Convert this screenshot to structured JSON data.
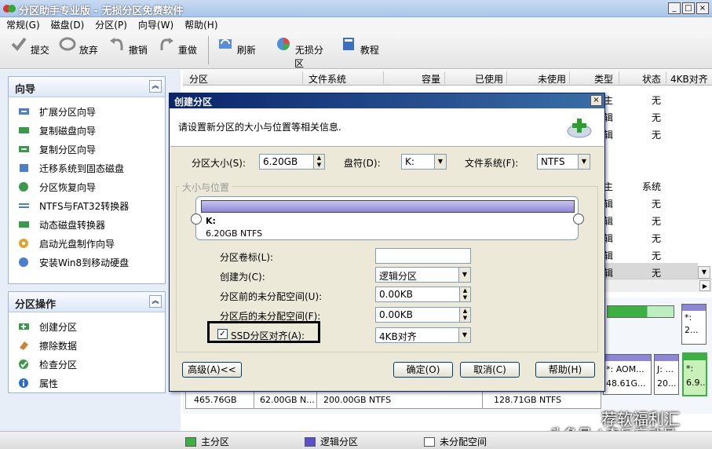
{
  "window": {
    "title": "分区助手专业版 - 无损分区免费软件",
    "min": "_",
    "max": "□",
    "close": "×"
  },
  "menu": [
    "常规(G)",
    "磁盘(D)",
    "分区(P)",
    "向导(W)",
    "帮助(H)"
  ],
  "toolbar": {
    "commit": "提交",
    "discard": "放弃",
    "undo": "撤销",
    "redo": "重做",
    "refresh": "刷新",
    "lossless": "无损分区",
    "tutorial": "教程"
  },
  "wizard_panel": {
    "title": "向导",
    "items": [
      "扩展分区向导",
      "复制磁盘向导",
      "复制分区向导",
      "迁移系统到固态磁盘",
      "分区恢复向导",
      "NTFS与FAT32转换器",
      "动态磁盘转换器",
      "启动光盘制作向导",
      "安装Win8到移动硬盘"
    ]
  },
  "ops_panel": {
    "title": "分区操作",
    "items": [
      "创建分区",
      "擦除数据",
      "检查分区",
      "属性"
    ]
  },
  "columns": [
    "分区",
    "文件系统",
    "容量",
    "已使用",
    "未使用",
    "类型",
    "状态",
    "4KB对齐"
  ],
  "visible_cells": {
    "type": [
      "主",
      "辑",
      "辑",
      "主",
      "辑",
      "辑",
      "辑",
      "辑",
      "辑"
    ],
    "status": [
      "无",
      "无",
      "无",
      "系统",
      "无",
      "无",
      "无",
      "无",
      "无"
    ]
  },
  "disk_map": {
    "disk_size": "465.76GB",
    "p1": "62.00GB N...",
    "p2": "200.00GB NTFS",
    "p3": "128.71GB NTFS",
    "p4_name": "*: AOM...",
    "p4_size": "48.61G...",
    "p5_name": "J: ...",
    "p5_size": "20...",
    "p6_name": "*:",
    "p6_size": "6.9..",
    "p7_name": "*:",
    "p7_size": "2..."
  },
  "legend": {
    "primary": "主分区",
    "logical": "逻辑分区",
    "unallocated": "未分配空间"
  },
  "watermark": {
    "line1": "荐软福利汇",
    "line2": "头条号 / 奇乐忘动员"
  },
  "dialog": {
    "title": "创建分区",
    "close": "×",
    "desc": "请设置新分区的大小与位置等相关信息.",
    "size_label": "分区大小(S):",
    "size_value": "6.20GB",
    "drive_label": "盘符(D):",
    "drive_value": "K:",
    "fs_label": "文件系统(F):",
    "fs_value": "NTFS",
    "group_label": "大小与位置",
    "bar_drive": "K:",
    "bar_info": "6.20GB NTFS",
    "volume_label": "分区卷标(L):",
    "volume_value": "",
    "create_as_label": "创建为(C):",
    "create_as_value": "逻辑分区",
    "before_label": "分区前的未分配空间(U):",
    "before_value": "0.00KB",
    "after_label": "分区后的未分配空间(F):",
    "after_value": "0.00KB",
    "ssd_label": "SSD分区对齐(A):",
    "ssd_check": "✓",
    "align_value": "4KB对齐",
    "advanced": "高级(A)<<",
    "ok": "确定(O)",
    "cancel": "取消(C)",
    "help": "帮助(H)"
  },
  "colors": {
    "primary": "#3cb043",
    "logical": "#5a4fcf",
    "unallocated": "#ffffff",
    "accent": "#0a246a"
  }
}
